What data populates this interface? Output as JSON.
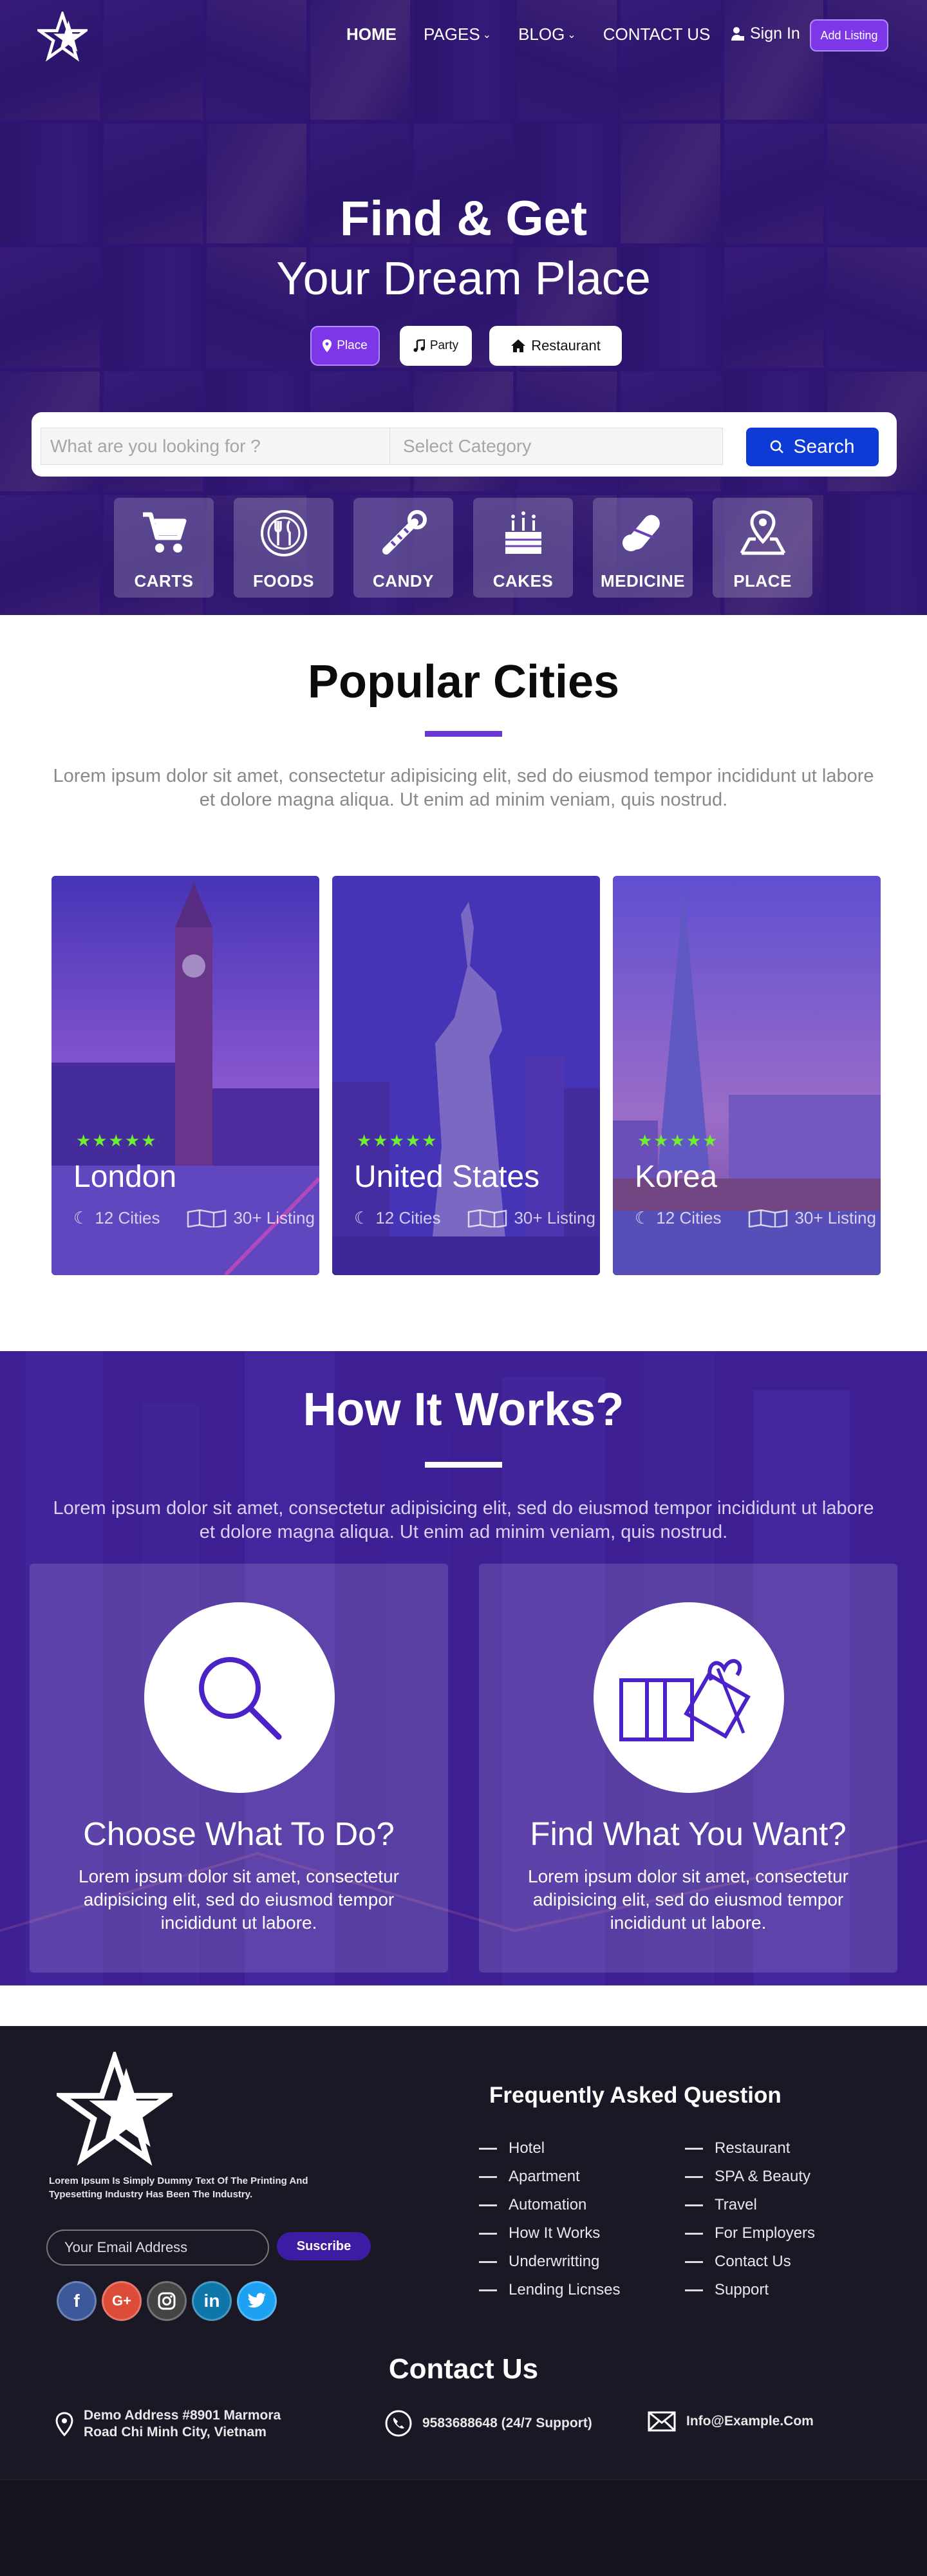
{
  "nav": {
    "links": [
      {
        "label": "HOME",
        "dropdown": false
      },
      {
        "label": "PAGES",
        "dropdown": true
      },
      {
        "label": "BLOG",
        "dropdown": true
      },
      {
        "label": "CONTACT US",
        "dropdown": false
      }
    ],
    "signin": "Sign In",
    "add_listing": "Add Listing"
  },
  "hero": {
    "title": "Find & Get",
    "subtitle": "Your Dream Place",
    "chips": [
      "Place",
      "Party",
      "Restaurant"
    ],
    "search": {
      "placeholder": "What are you looking for ?",
      "category": "Select Category",
      "button": "Search"
    },
    "categories": [
      "CARTS",
      "FOODS",
      "CANDY",
      "CAKES",
      "MEDICINE",
      "PLACE"
    ]
  },
  "cities": {
    "title": "Popular Cities",
    "description": "Lorem ipsum dolor sit amet, consectetur adipisicing elit, sed do eiusmod tempor incididunt ut labore et dolore magna aliqua. Ut enim ad minim veniam, quis nostrud.",
    "items": [
      {
        "name": "London",
        "cities": "12 Cities",
        "listing": "30+ Listing",
        "rating": 5
      },
      {
        "name": "United States",
        "cities": "12 Cities",
        "listing": "30+ Listing",
        "rating": 5
      },
      {
        "name": "Korea",
        "cities": "12 Cities",
        "listing": "30+ Listing",
        "rating": 5
      }
    ]
  },
  "how": {
    "title": "How It Works?",
    "description": "Lorem ipsum dolor sit amet, consectetur adipisicing elit, sed do eiusmod tempor incididunt ut labore et dolore magna aliqua. Ut enim ad minim veniam, quis nostrud.",
    "cards": [
      {
        "title": "Choose What To Do?",
        "text": "Lorem ipsum dolor sit amet, consectetur adipisicing elit, sed do eiusmod tempor incididunt ut labore."
      },
      {
        "title": "Find What You Want?",
        "text": "Lorem ipsum dolor sit amet, consectetur adipisicing elit, sed do eiusmod tempor incididunt ut labore."
      }
    ]
  },
  "footer": {
    "about": "Lorem Ipsum Is Simply Dummy Text Of The Printing And Typesetting Industry Has Been The Industry.",
    "email_placeholder": "Your Email Address",
    "subscribe": "Suscribe",
    "socials": [
      "facebook-icon",
      "google-plus-icon",
      "instagram-icon",
      "linkedin-icon",
      "twitter-icon"
    ],
    "faq_title": "Frequently Asked Question",
    "faq_left": [
      "Hotel",
      "Apartment",
      "Automation",
      "How It Works",
      "Underwritting",
      "Lending Licnses"
    ],
    "faq_right": [
      "Restaurant",
      "SPA & Beauty",
      "Travel",
      "For Employers",
      "Contact Us",
      "Support"
    ],
    "contact_title": "Contact Us",
    "address_line1": "Demo Address #8901 Marmora",
    "address_line2": "Road Chi Minh City, Vietnam",
    "phone": "9583688648 (24/7 Support)",
    "email": "Info@Example.Com"
  },
  "colors": {
    "accent": "#7d37e8",
    "search_button": "#0e3ad6",
    "stars": "#6fef2d",
    "footer_bg": "#1b1826"
  }
}
